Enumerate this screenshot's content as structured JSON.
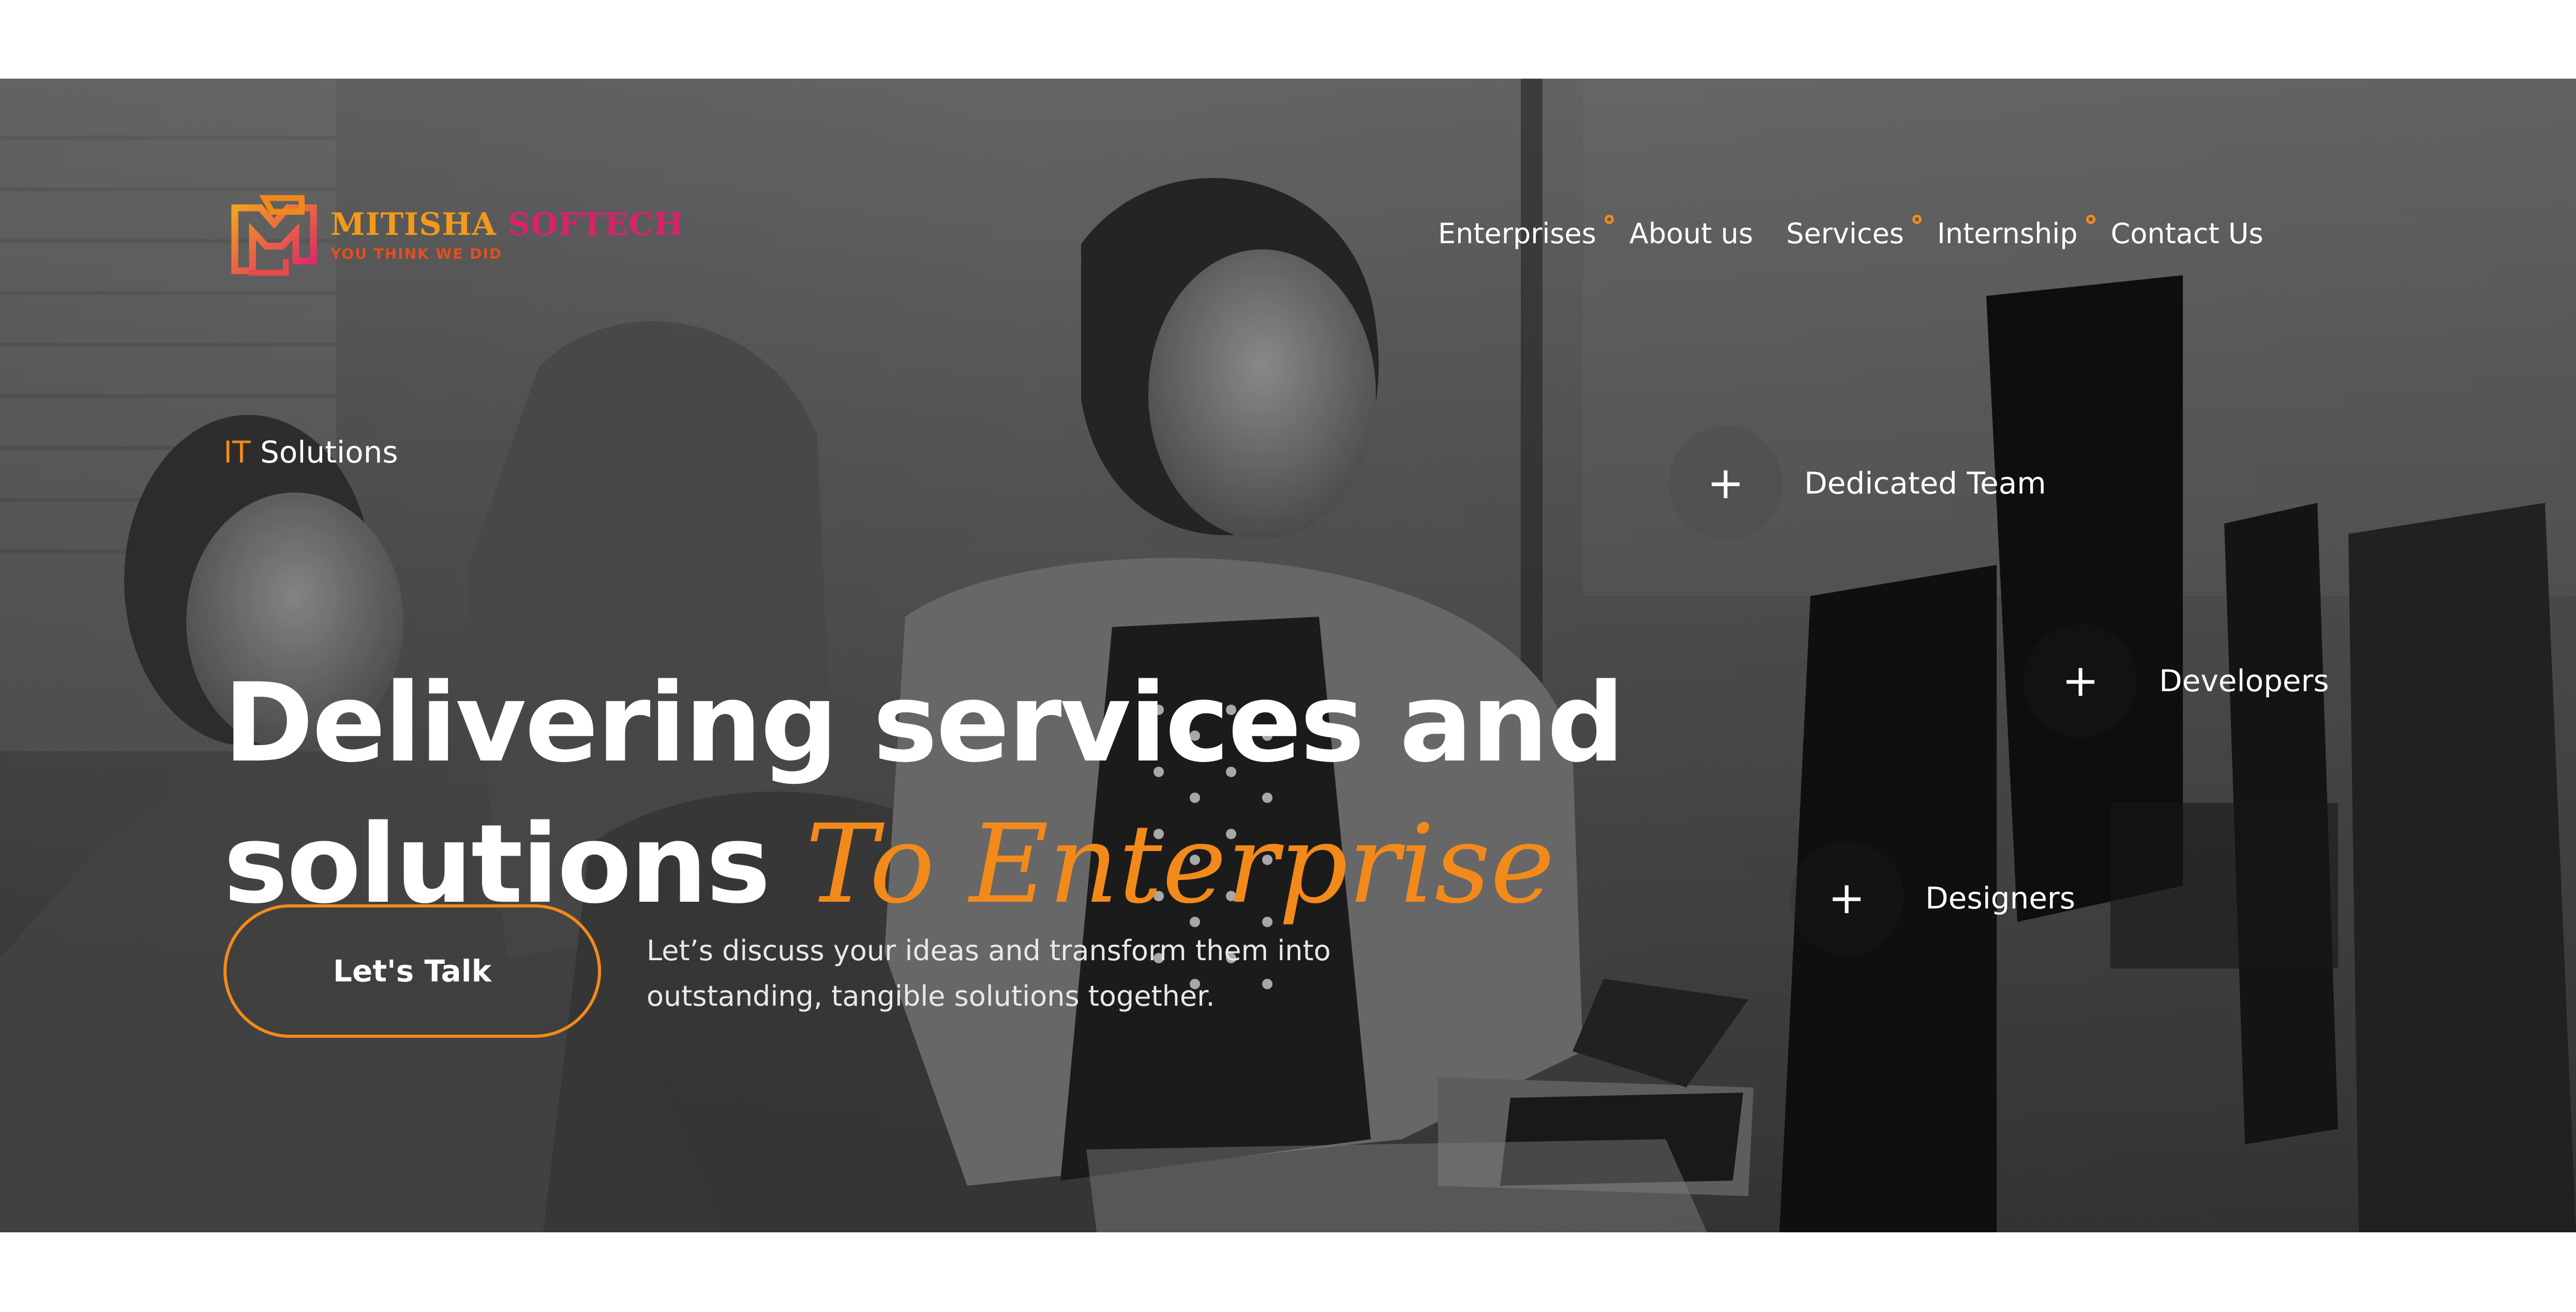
{
  "brand": {
    "name_left": "MITISHA",
    "name_right": "SOFTECH",
    "tagline": "YOU THINK WE DID",
    "logo_icon": "ms-monogram-logo-icon",
    "colors": {
      "orange": "#f39a1a",
      "pink": "#d8236b",
      "red": "#e44f1f"
    }
  },
  "nav": {
    "items": [
      {
        "label": "Enterprises",
        "has_indicator": true
      },
      {
        "label": "About us",
        "has_indicator": false
      },
      {
        "label": "Services",
        "has_indicator": true
      },
      {
        "label": "Internship",
        "has_indicator": true
      },
      {
        "label": "Contact Us",
        "has_indicator": false
      }
    ],
    "indicator_icon": "ring-dot-icon",
    "indicator_color": "#f28a1b"
  },
  "hero": {
    "eyebrow_prefix": "IT",
    "eyebrow_text": "Solutions",
    "headline_line1": "Delivering services and",
    "headline_line2_prefix": "solutions",
    "headline_line2_script": "To Enterprise",
    "cta_label": "Let's Talk",
    "description_line1": "Let’s discuss your ideas and transform them into",
    "description_line2": "outstanding, tangible solutions together.",
    "accent_color": "#f28a1b"
  },
  "features": [
    {
      "label": "Dedicated Team",
      "icon": "plus-icon"
    },
    {
      "label": "Developers",
      "icon": "plus-icon"
    },
    {
      "label": "Designers",
      "icon": "plus-icon"
    }
  ]
}
